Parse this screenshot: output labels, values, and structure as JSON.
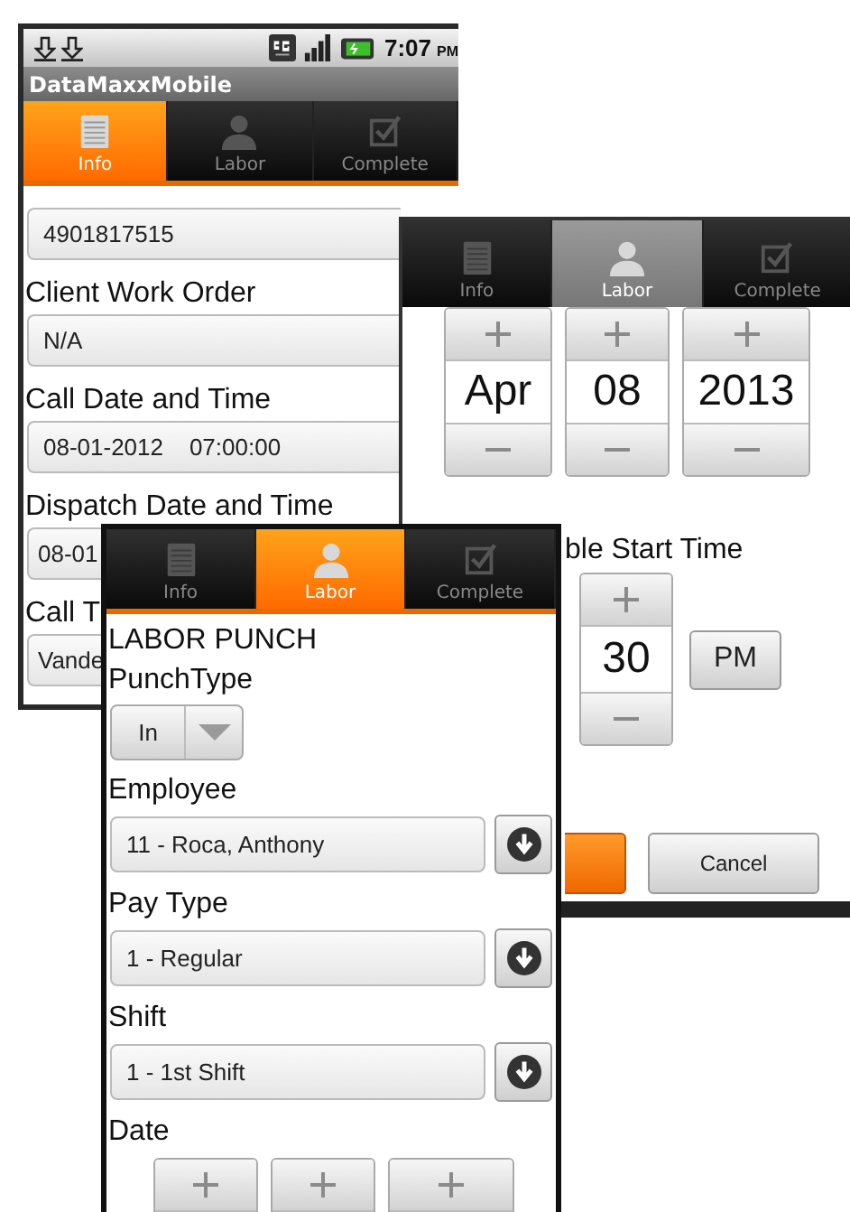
{
  "back_screen": {
    "status_bar": {
      "time": "7:07",
      "meridiem": "PM"
    },
    "app_title": "DataMaxxMobile",
    "tabs": [
      {
        "label": "Info",
        "selected": true,
        "pressed": false
      },
      {
        "label": "Labor",
        "selected": false,
        "pressed": false
      },
      {
        "label": "Complete",
        "selected": false,
        "pressed": false
      }
    ],
    "fields": [
      {
        "value": "4901817515"
      },
      {
        "label": "Client Work Order",
        "value": "N/A"
      },
      {
        "label": "Call Date and Time",
        "value": "08-01-2012    07:00:00"
      },
      {
        "label": "Dispatch Date and Time",
        "value": "08-01"
      },
      {
        "label": "Call T",
        "value": "Vande"
      }
    ]
  },
  "middle_screen": {
    "tabs": [
      {
        "label": "Info",
        "selected": false,
        "pressed": false
      },
      {
        "label": "Labor",
        "selected": true,
        "pressed": true
      },
      {
        "label": "Complete",
        "selected": false,
        "pressed": false
      }
    ],
    "date_picker": [
      "Apr",
      "08",
      "2013"
    ],
    "time_label": "ble Start Time",
    "time_picker": [
      "30"
    ],
    "meridiem_button": "PM",
    "cancel_button": "Cancel"
  },
  "front_screen": {
    "tabs": [
      {
        "label": "Info",
        "selected": false,
        "pressed": false
      },
      {
        "label": "Labor",
        "selected": true,
        "pressed": false
      },
      {
        "label": "Complete",
        "selected": false,
        "pressed": false
      }
    ],
    "section_title": "LABOR PUNCH",
    "punch_type": {
      "label": "PunchType",
      "value": "In"
    },
    "selects": [
      {
        "label": "Employee",
        "value": "11 - Roca, Anthony"
      },
      {
        "label": "Pay Type",
        "value": "1 - Regular"
      },
      {
        "label": "Shift",
        "value": "1 - 1st Shift"
      }
    ],
    "date_label": "Date"
  }
}
